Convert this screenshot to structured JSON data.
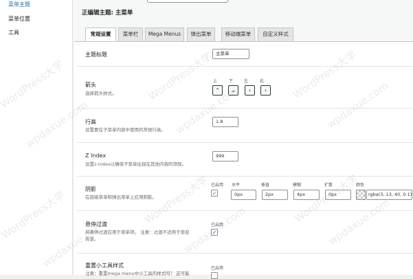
{
  "sidebar": {
    "items": [
      {
        "label": "菜单主题",
        "active": true
      },
      {
        "label": "菜单位置",
        "active": false
      },
      {
        "label": "工具",
        "active": false
      }
    ]
  },
  "header": {
    "editing_title": "正编辑主题: 主菜单"
  },
  "tabs": [
    {
      "label": "常规设置",
      "active": true
    },
    {
      "label": "菜单栏",
      "active": false
    },
    {
      "label": "Mega Menus",
      "active": false
    },
    {
      "label": "弹出菜单",
      "active": false
    },
    {
      "label": "移动端菜单",
      "active": false
    },
    {
      "label": "自定义样式",
      "active": false
    }
  ],
  "settings": {
    "theme_title": {
      "label": "主题标题",
      "value": "主菜单"
    },
    "arrow": {
      "label": "箭头",
      "description": "选择箭头样式。",
      "directions": [
        "上",
        "下",
        "左",
        "右"
      ],
      "icons": [
        "arrow-up-icon",
        "arrow-down-icon",
        "arrow-left-icon",
        "arrow-right-icon"
      ]
    },
    "line_height": {
      "label": "行高",
      "description": "设置要在子菜单内容中使用的常规行高。",
      "value": "1.8"
    },
    "z_index": {
      "label": "Z Index",
      "description": "设置z-index以确保子菜单出现在其他内容的顶部。",
      "value": "999"
    },
    "shadow": {
      "label": "阴影",
      "description": "在超级菜单和弹出菜单上应用阴影。",
      "enabled_label": "已启用",
      "enabled": true,
      "horizontal": {
        "label": "水平",
        "value": "0px"
      },
      "vertical": {
        "label": "垂直",
        "value": "2px"
      },
      "blur": {
        "label": "模糊",
        "value": "4px"
      },
      "spread": {
        "label": "扩散",
        "value": "0px"
      },
      "color": {
        "label": "颜色",
        "value": "rgba(3, 13, 40, 0.1)"
      }
    },
    "hover_transition": {
      "label": "悬停过渡",
      "description_line1": "将悬停过渡应用于菜单项。 注意：过渡不适用于渐变",
      "description_line2": "背景。",
      "enabled_label": "已启用",
      "enabled": true
    },
    "reset_widgets": {
      "label": "重置小工具样式",
      "description": "注意：重置mega menu中小工具的样式吗？ 这可能",
      "enabled_label": "已启用"
    }
  },
  "watermarks": [
    "WordPress大学",
    "wpdaxue.com"
  ],
  "colors": {
    "accent": "#2271b1",
    "text": "#1d2327",
    "muted": "#646970"
  }
}
